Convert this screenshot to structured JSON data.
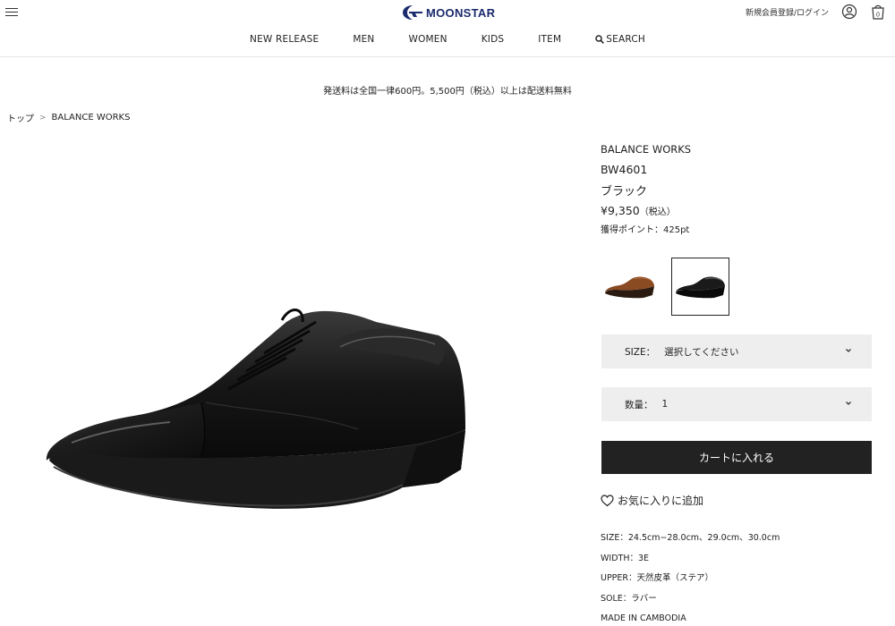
{
  "header": {
    "logo_text": "MOONSTAR",
    "login_label": "新規会員登録/ログイン",
    "brand_color": "#1c2a6e"
  },
  "nav": {
    "items": [
      "NEW RELEASE",
      "MEN",
      "WOMEN",
      "KIDS",
      "ITEM"
    ],
    "search_label": "SEARCH"
  },
  "notice": "発送料は全国一律600円。5,500円（税込）以上は配送料無料",
  "breadcrumb": {
    "home": "トップ",
    "separator": ">",
    "current": "BALANCE WORKS"
  },
  "product": {
    "brand": "BALANCE WORKS",
    "model": "BW4601",
    "color": "ブラック",
    "price": "¥9,350",
    "tax_label": "（税込）",
    "points": "獲得ポイント：425pt"
  },
  "swatches": [
    {
      "name": "brown",
      "color": "#8a4a22",
      "selected": false
    },
    {
      "name": "black",
      "color": "#1a1a1a",
      "selected": true
    }
  ],
  "size_select": {
    "label": "SIZE：",
    "value": "選択してください"
  },
  "qty_select": {
    "label": "数量：",
    "value": "1"
  },
  "cart_button": "カートに入れる",
  "favorite": "お気に入りに追加",
  "specs": [
    "SIZE：24.5cm−28.0cm、29.0cm、30.0cm",
    "WIDTH：3E",
    "UPPER：天然皮革（ステア）",
    "SOLE：ラバー",
    "MADE IN CAMBODIA"
  ]
}
